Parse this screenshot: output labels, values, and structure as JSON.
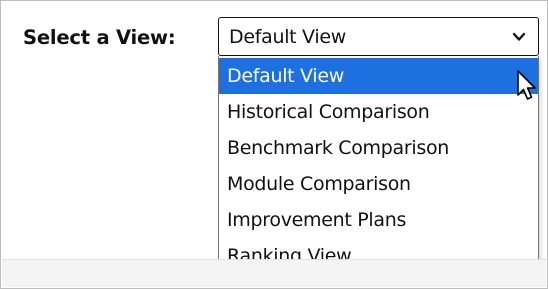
{
  "view_selector": {
    "label": "Select a View:",
    "selected_value": "Default View",
    "chevron_icon": "chevron-down-icon",
    "options": [
      "Default View",
      "Historical Comparison",
      "Benchmark Comparison",
      "Module Comparison",
      "Improvement Plans",
      "Ranking View"
    ],
    "highlighted_option": "Default View"
  },
  "cursor_icon": "mouse-pointer-icon",
  "colors": {
    "highlight": "#1e6fe0",
    "text": "#111111",
    "border": "#767676"
  }
}
